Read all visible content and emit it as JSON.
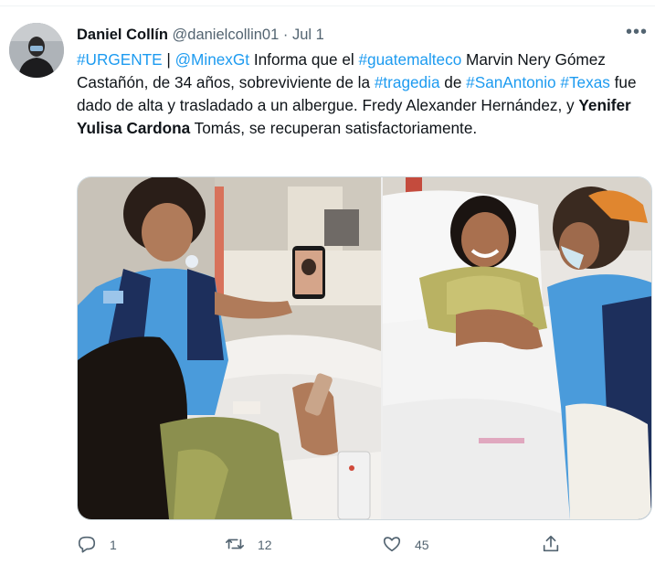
{
  "tweet": {
    "author_name": "Daniel Collín",
    "author_handle": "@danielcollin01",
    "separator": "·",
    "date": "Jul 1",
    "more_label": "•••",
    "text": {
      "part1": "#URGENTE",
      "part2": " | ",
      "part3": "@MinexGt",
      "part4": " Informa que el ",
      "part5": "#guatemalteco",
      "part6": " Marvin Nery Gómez Castañón, de 34 años, sobreviviente de la ",
      "part7": "#tragedia",
      "part8": " de ",
      "part9": "#SanAntonio",
      "part10": "#Texas",
      "part11": " fue dado de alta y trasladado a un albergue. Fredy Alexander Hernández,  y ",
      "part12": "Yenifer Yulisa Cardona",
      "part13": " Tomás, se recuperan satisfactoriamente."
    }
  },
  "actions": {
    "reply_count": "1",
    "retweet_count": "12",
    "like_count": "45"
  },
  "colors": {
    "link": "#1d9bf0",
    "secondary_text": "#536471",
    "uniform_blue": "#4a9bdb"
  },
  "icons": [
    "reply-icon",
    "retweet-icon",
    "like-icon",
    "share-icon",
    "more-icon"
  ]
}
